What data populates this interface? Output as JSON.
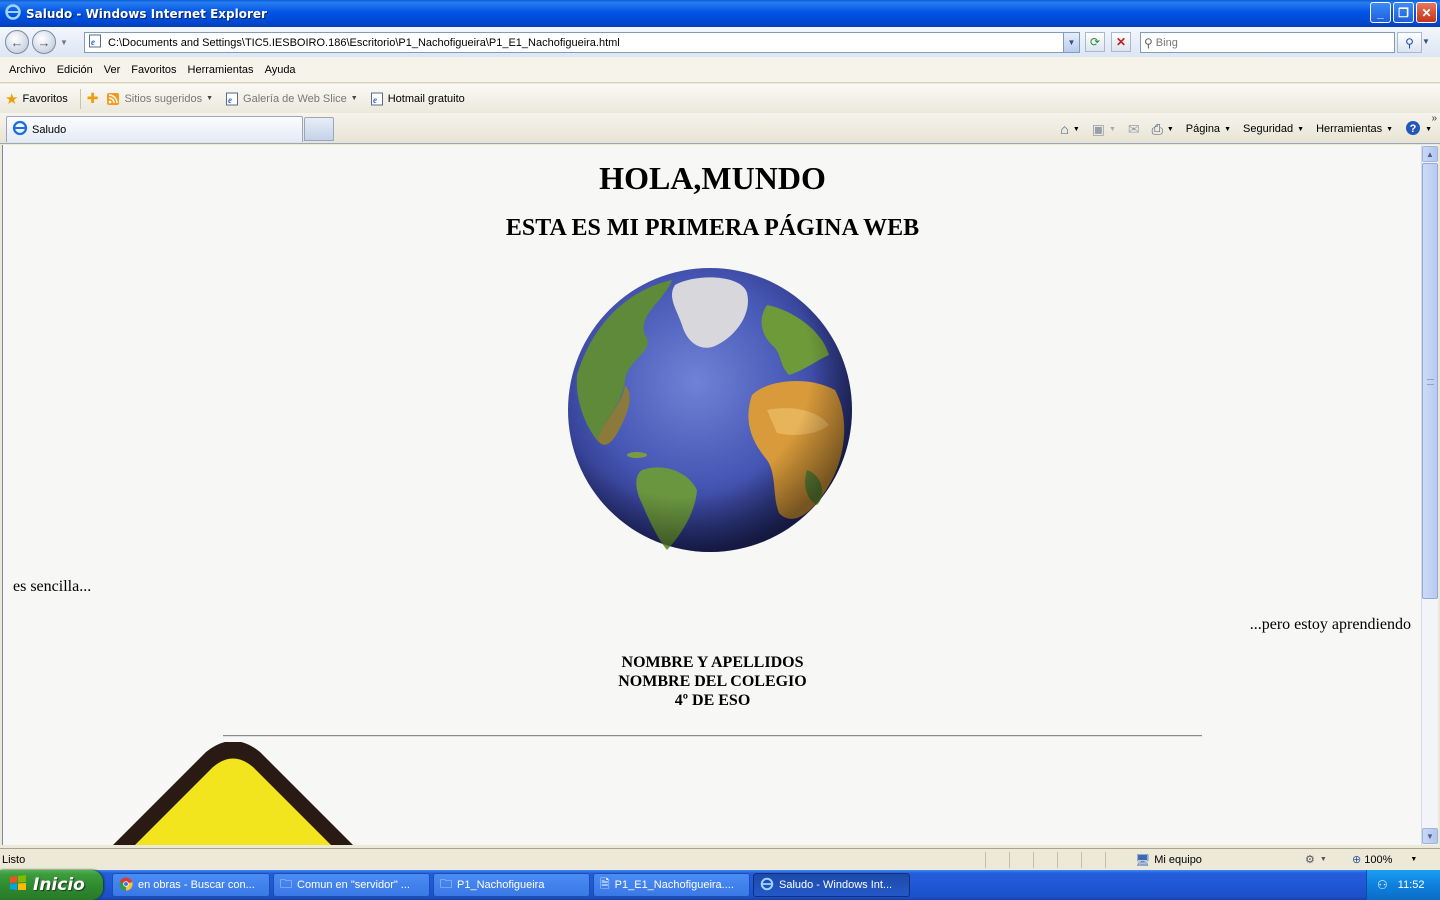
{
  "window": {
    "title": "Saludo - Windows Internet Explorer",
    "controls": {
      "minimize": "_",
      "restore": "❐",
      "close": "✕"
    }
  },
  "address_bar": {
    "url": "C:\\Documents and Settings\\TIC5.IESBOIRO.186\\Escritorio\\P1_Nachofigueira\\P1_E1_Nachofigueira.html",
    "search_placeholder": "Bing"
  },
  "menu": [
    "Archivo",
    "Edición",
    "Ver",
    "Favoritos",
    "Herramientas",
    "Ayuda"
  ],
  "favorites_bar": {
    "favorites_label": "Favoritos",
    "links": [
      {
        "label": "Sitios sugeridos",
        "icon": "rss-icon",
        "has_dropdown": true,
        "dimmed": true
      },
      {
        "label": "Galería de Web Slice",
        "icon": "ie-page-icon",
        "has_dropdown": true,
        "dimmed": true
      },
      {
        "label": "Hotmail gratuito",
        "icon": "ie-page-icon",
        "has_dropdown": false,
        "dimmed": false
      }
    ]
  },
  "tabs": [
    {
      "label": "Saludo",
      "active": true
    }
  ],
  "command_bar": {
    "page": "Página",
    "security": "Seguridad",
    "tools": "Herramientas"
  },
  "page": {
    "heading": "HOLA,MUNDO",
    "subheading": "ESTA ES MI PRIMERA PÁGINA WEB",
    "left_text": "es sencilla...",
    "right_text": "...pero estoy aprendiendo",
    "info_lines": [
      "NOMBRE Y APELLIDOS",
      "NOMBRE DEL COLEGIO",
      "4º DE ESO"
    ]
  },
  "status_bar": {
    "status": "Listo",
    "zone": "Mi equipo",
    "zoom": "100%"
  },
  "taskbar": {
    "start_label": "Inicio",
    "tasks": [
      {
        "label": "en obras - Buscar con...",
        "icon": "chrome-icon",
        "active": false
      },
      {
        "label": "Comun en \"servidor\" ...",
        "icon": "network-folder-icon",
        "active": false
      },
      {
        "label": "P1_Nachofigueira",
        "icon": "folder-icon",
        "active": false
      },
      {
        "label": "P1_E1_Nachofigueira....",
        "icon": "notepad-icon",
        "active": false
      },
      {
        "label": "Saludo - Windows Int...",
        "icon": "ie-icon",
        "active": true
      }
    ],
    "clock": "11:52"
  },
  "colors": {
    "titlebar_blue": "#0055e5",
    "taskbar_blue": "#245edb",
    "start_green": "#3c9c3c",
    "page_background": "#f7f7f6",
    "sign_yellow": "#f2e51e"
  }
}
